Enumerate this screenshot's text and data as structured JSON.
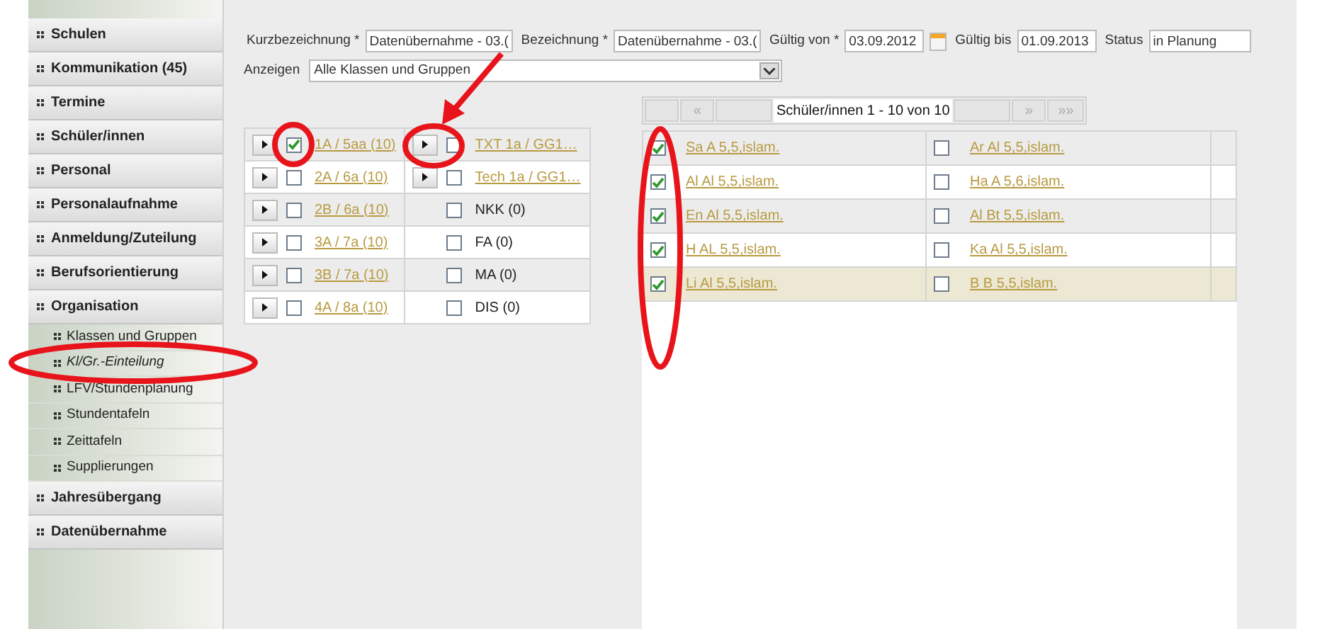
{
  "sidebar": {
    "items": [
      {
        "label": "Schulen",
        "kind": "group",
        "selected": false
      },
      {
        "label": "Kommunikation (45)",
        "kind": "group",
        "selected": false
      },
      {
        "label": "Termine",
        "kind": "group",
        "selected": false
      },
      {
        "label": "Schüler/innen",
        "kind": "group",
        "selected": false
      },
      {
        "label": "Personal",
        "kind": "group",
        "selected": false
      },
      {
        "label": "Personalaufnahme",
        "kind": "group",
        "selected": false
      },
      {
        "label": "Anmeldung/Zuteilung",
        "kind": "group",
        "selected": false
      },
      {
        "label": "Berufsorientierung",
        "kind": "group",
        "selected": false
      },
      {
        "label": "Organisation",
        "kind": "group",
        "selected": false
      },
      {
        "label": "Klassen und Gruppen",
        "kind": "sub",
        "selected": false
      },
      {
        "label": "Kl/Gr.-Einteilung",
        "kind": "sub",
        "selected": true
      },
      {
        "label": "LFV/Stundenplanung",
        "kind": "sub",
        "selected": false
      },
      {
        "label": "Stundentafeln",
        "kind": "sub",
        "selected": false
      },
      {
        "label": "Zeittafeln",
        "kind": "sub",
        "selected": false
      },
      {
        "label": "Supplierungen",
        "kind": "sub",
        "selected": false
      },
      {
        "label": "Jahresübergang",
        "kind": "group",
        "selected": false
      },
      {
        "label": "Datenübernahme",
        "kind": "group",
        "selected": false
      }
    ]
  },
  "form": {
    "fields": [
      {
        "label": "Kurzbezeichnung *",
        "value": "Datenübernahme - 03.(",
        "calendar": false
      },
      {
        "label": "Bezeichnung *",
        "value": "Datenübernahme - 03.(",
        "calendar": false
      },
      {
        "label": "Gültig von *",
        "value": "03.09.2012",
        "calendar": true
      },
      {
        "label": "Gültig bis",
        "value": "01.09.2013",
        "calendar": false
      },
      {
        "label": "Status",
        "value": "in Planung",
        "calendar": false
      }
    ],
    "filter": {
      "label": "Anzeigen",
      "value": "Alle Klassen und Gruppen"
    }
  },
  "classes": {
    "rows": [
      {
        "left": {
          "label": "1A / 5aa (10)",
          "checked": true,
          "expandable": true,
          "link": true
        },
        "right": {
          "label": "TXT 1a / GG1…",
          "checked": false,
          "expandable": true,
          "link": true
        }
      },
      {
        "left": {
          "label": "2A / 6a (10)",
          "checked": false,
          "expandable": true,
          "link": true
        },
        "right": {
          "label": "Tech 1a / GG1…",
          "checked": false,
          "expandable": true,
          "link": true
        }
      },
      {
        "left": {
          "label": "2B / 6a (10)",
          "checked": false,
          "expandable": true,
          "link": true
        },
        "right": {
          "label": "NKK (0)",
          "checked": false,
          "expandable": false,
          "link": false
        }
      },
      {
        "left": {
          "label": "3A / 7a (10)",
          "checked": false,
          "expandable": true,
          "link": true
        },
        "right": {
          "label": "FA (0)",
          "checked": false,
          "expandable": false,
          "link": false
        }
      },
      {
        "left": {
          "label": "3B / 7a (10)",
          "checked": false,
          "expandable": true,
          "link": true
        },
        "right": {
          "label": "MA (0)",
          "checked": false,
          "expandable": false,
          "link": false
        }
      },
      {
        "left": {
          "label": "4A / 8a (10)",
          "checked": false,
          "expandable": true,
          "link": true
        },
        "right": {
          "label": "DIS (0)",
          "checked": false,
          "expandable": false,
          "link": false
        }
      }
    ]
  },
  "students": {
    "pager": {
      "prev": "«",
      "info": "Schüler/innen 1 - 10 von 10",
      "next": "»",
      "last": "»»"
    },
    "rows": [
      {
        "highlighted": false,
        "cells": [
          {
            "label": "Sa A 5,5,islam.",
            "checked": true
          },
          {
            "label": "Ar Al 5,5,islam.",
            "checked": false
          }
        ]
      },
      {
        "highlighted": false,
        "cells": [
          {
            "label": "Al Al 5,5,islam.",
            "checked": true
          },
          {
            "label": "Ha A 5,6,islam.",
            "checked": false
          }
        ]
      },
      {
        "highlighted": false,
        "cells": [
          {
            "label": "En Al 5,5,islam.",
            "checked": true
          },
          {
            "label": "Al Bt 5,5,islam.",
            "checked": false
          }
        ]
      },
      {
        "highlighted": false,
        "cells": [
          {
            "label": "H AL 5,5,islam.",
            "checked": true
          },
          {
            "label": "Ka Al 5,5,islam.",
            "checked": false
          }
        ]
      },
      {
        "highlighted": true,
        "cells": [
          {
            "label": "Li Al 5,5,islam.",
            "checked": true
          },
          {
            "label": "B B 5,5,islam.",
            "checked": false
          }
        ]
      }
    ]
  }
}
